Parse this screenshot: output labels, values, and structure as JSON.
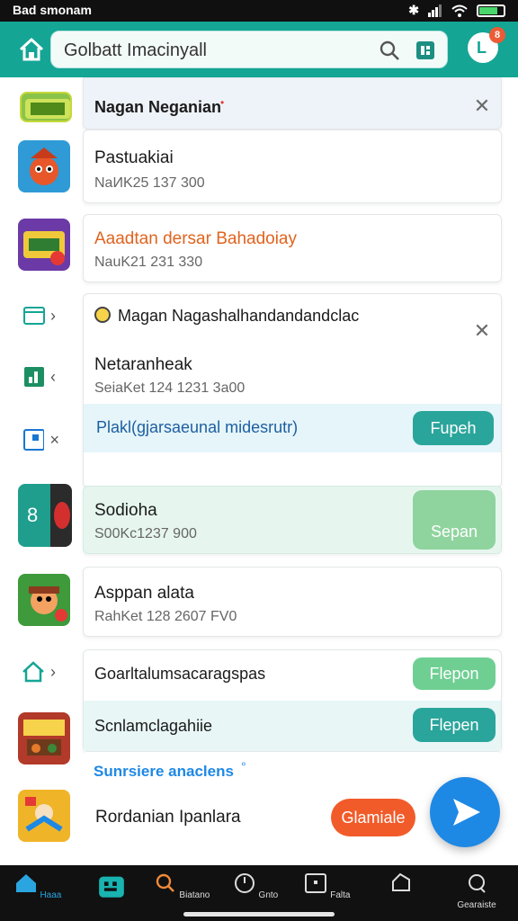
{
  "status": {
    "time": "Bad smonam"
  },
  "header": {
    "search_value": "Golbatt Imacinyall",
    "notif_count": "8",
    "avatar_letter": "L"
  },
  "list": {
    "c1": {
      "title": "Nagan Neganian",
      "mark": "•"
    },
    "c2": {
      "title": "Pastuakiai",
      "sub": "NaИK25 137 300"
    },
    "c3": {
      "title": "Aaadtan dersar Bahadoiay",
      "sub": "NauK21 231 330"
    },
    "c4": {
      "title": "Magan Nagashalhandandandclac",
      "sub_title": "Netaranheak",
      "sub_meta": "SeiaKet 124 1231 3a00",
      "action_text": "Plakl(gjarsaeunal midesrutr)",
      "action_btn": "Fupeh"
    },
    "c5": {
      "title": "Sodioha",
      "sub": "S00Kc1237 900",
      "btn": "Sepan",
      "badge": "8"
    },
    "c6": {
      "title": "Asppan alata",
      "sub": "RahKet 128 2607 FV0"
    },
    "c7": {
      "row1": "Goarltalumsacaragspas",
      "row1_btn": "Flepon",
      "row2": "Scnlamclagahiie",
      "row2_btn": "Flepen"
    },
    "c8": {
      "section": "Sunrsiere anaclens",
      "mark": "°",
      "row": "Rordanian Ipanlara",
      "btn": "Glamiale"
    }
  },
  "bottom_nav": [
    {
      "label": "Haaa"
    },
    {
      "label": ""
    },
    {
      "label": "Biatano"
    },
    {
      "label": "Gnto"
    },
    {
      "label": "Falta"
    },
    {
      "label": ""
    },
    {
      "label": "Gearaiste"
    }
  ]
}
